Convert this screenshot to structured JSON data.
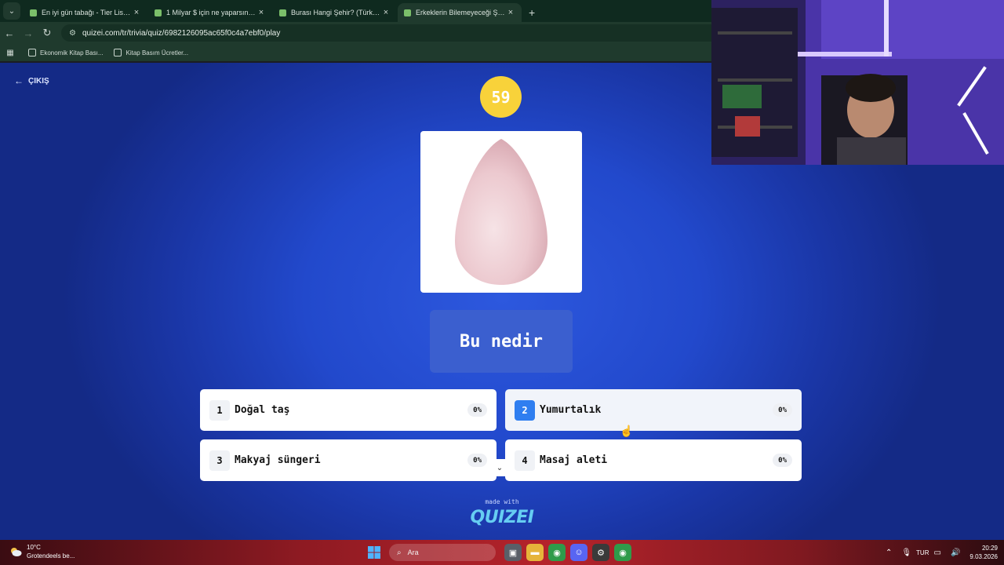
{
  "browser": {
    "tabs": [
      {
        "title": "En iyi gün tabağı - Tier List, Kc",
        "active": false
      },
      {
        "title": "1 Milyar $ için ne yaparsın? - Ti",
        "active": false
      },
      {
        "title": "Burası Hangi Şehir? (Türkiye) - (",
        "active": false
      },
      {
        "title": "Erkeklerin Bilemeyeceği Şeyler",
        "active": true
      }
    ],
    "url": "quizei.com/tr/trivia/quiz/6982126095ac65f0c4a7ebf0/play",
    "bookmarks": [
      "Ekonomik Kitap Bası...",
      "Kitap Basım Ücretler..."
    ]
  },
  "quiz": {
    "exit_label": "ÇIKIŞ",
    "timer": "59",
    "question": "Bu nedir",
    "answers": [
      {
        "num": "1",
        "label": "Doğal taş",
        "pct": "0%"
      },
      {
        "num": "2",
        "label": "Yumurtalık",
        "pct": "0%"
      },
      {
        "num": "3",
        "label": "Makyaj süngeri",
        "pct": "0%"
      },
      {
        "num": "4",
        "label": "Masaj aleti",
        "pct": "0%"
      }
    ],
    "made_with": "made with",
    "brand": "QUIZEI"
  },
  "taskbar": {
    "weather_temp": "10°C",
    "weather_desc": "Grotendeels be...",
    "search_placeholder": "Ara",
    "language": "TUR",
    "time": "20:29",
    "date": "9.03.2026"
  },
  "colors": {
    "page_bg": "#2249cc",
    "timer": "#f8d23a",
    "answer_badge_active": "#2f7ef0",
    "brand": "#66cdf2"
  }
}
